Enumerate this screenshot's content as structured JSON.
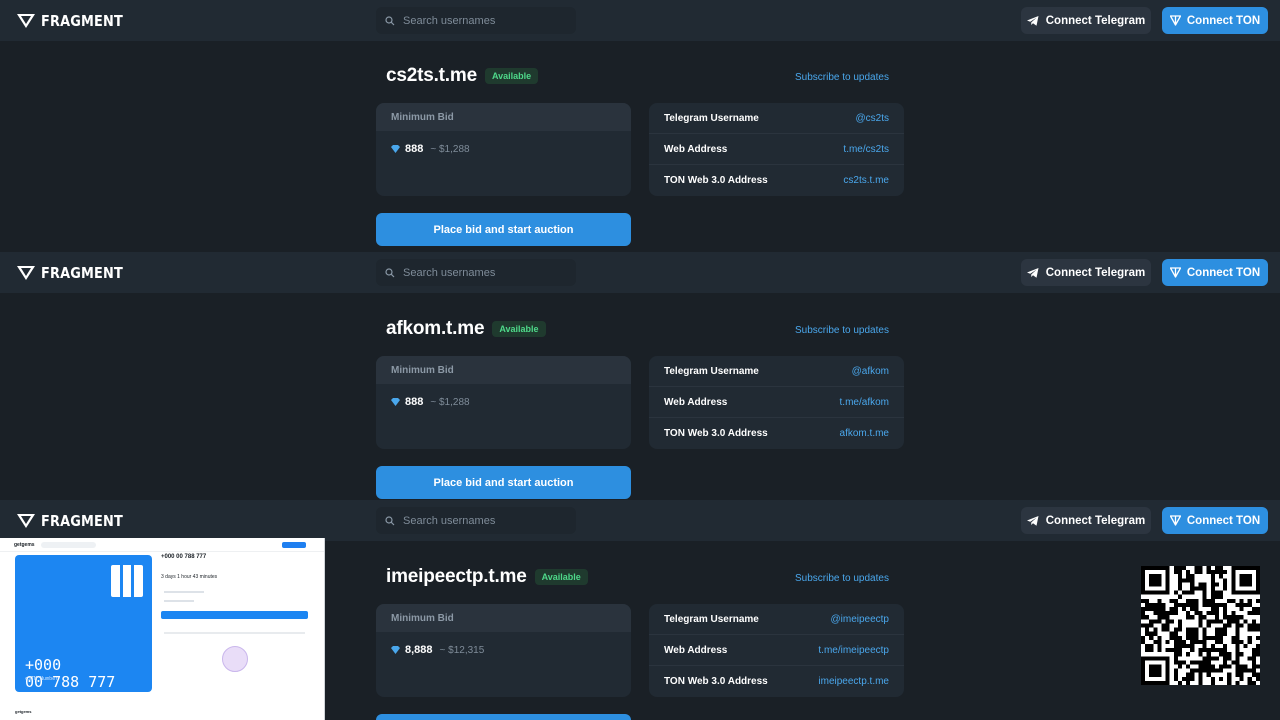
{
  "brand": {
    "name": "FRAGMENT"
  },
  "header": {
    "search_placeholder": "Search usernames",
    "connect_telegram": "Connect Telegram",
    "connect_ton": "Connect TON"
  },
  "colors": {
    "accent": "#2d8fe0",
    "link": "#4aa7ec",
    "available_green": "#4ed889",
    "bg": "#1a2026",
    "panel": "#212a33"
  },
  "auctions": [
    {
      "title": "cs2ts.t.me",
      "badge": "Available",
      "subscribe": "Subscribe to updates",
      "min_bid_label": "Minimum Bid",
      "bid_amount": "888",
      "bid_usd": "~ $1,288",
      "info": [
        {
          "label": "Telegram Username",
          "value": "@cs2ts"
        },
        {
          "label": "Web Address",
          "value": "t.me/cs2ts"
        },
        {
          "label": "TON Web 3.0 Address",
          "value": "cs2ts.t.me"
        }
      ],
      "action": "Place bid and start auction"
    },
    {
      "title": "afkom.t.me",
      "badge": "Available",
      "subscribe": "Subscribe to updates",
      "min_bid_label": "Minimum Bid",
      "bid_amount": "888",
      "bid_usd": "~ $1,288",
      "info": [
        {
          "label": "Telegram Username",
          "value": "@afkom"
        },
        {
          "label": "Web Address",
          "value": "t.me/afkom"
        },
        {
          "label": "TON Web 3.0 Address",
          "value": "afkom.t.me"
        }
      ],
      "action": "Place bid and start auction"
    },
    {
      "title": "imeipeectp.t.me",
      "badge": "Available",
      "subscribe": "Subscribe to updates",
      "min_bid_label": "Minimum Bid",
      "bid_amount": "8,888",
      "bid_usd": "~ $12,315",
      "info": [
        {
          "label": "Telegram Username",
          "value": "@imeipeectp"
        },
        {
          "label": "Web Address",
          "value": "t.me/imeipeectp"
        },
        {
          "label": "TON Web 3.0 Address",
          "value": "imeipeectp.t.me"
        }
      ]
    }
  ],
  "thumbnail": {
    "brand": "getgems",
    "number_title": "+000 00 788 777",
    "time_left": "3 days 1 hour 43 minutes",
    "card_number_line1": "+000",
    "card_number_line2": "00 788 777",
    "card_caption": "cSTM Number",
    "footer_brand": "getgems"
  }
}
